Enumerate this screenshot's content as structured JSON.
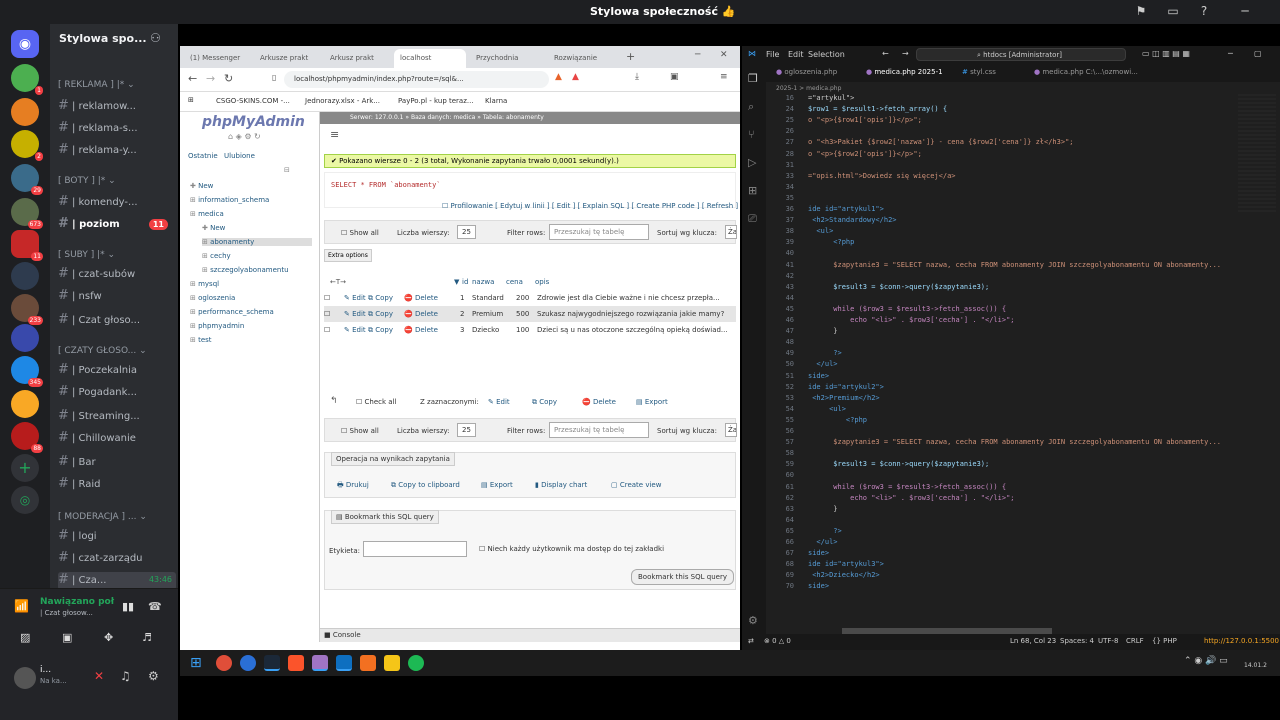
{
  "window": {
    "title": "Stylowa społeczność 👍"
  },
  "discord": {
    "server_name": "Stylowa spo...",
    "server_badges": [
      "1",
      "2",
      "29",
      "673",
      "11",
      "233",
      "345",
      "88"
    ],
    "channels": [
      {
        "type": "cat",
        "label": "[ REKLAMA ] |* ⌄"
      },
      {
        "type": "ch",
        "label": "| reklamow..."
      },
      {
        "type": "ch",
        "label": "| reklama-s..."
      },
      {
        "type": "ch",
        "label": "| reklama-y..."
      },
      {
        "type": "cat",
        "label": "[ BOTY ] |* ⌄"
      },
      {
        "type": "ch",
        "label": "| komendy-..."
      },
      {
        "type": "ch",
        "label": "| poziom",
        "badge": "11"
      },
      {
        "type": "cat",
        "label": "[ SUBY ] |* ⌄"
      },
      {
        "type": "ch",
        "label": "| czat-subów"
      },
      {
        "type": "ch",
        "label": "| nsfw"
      },
      {
        "type": "ch",
        "label": "| Czat głoso..."
      },
      {
        "type": "cat",
        "label": "[ CZATY GŁOSO... ⌄"
      },
      {
        "type": "ch",
        "label": "| Poczekalnia"
      },
      {
        "type": "ch",
        "label": "| Pogadank..."
      },
      {
        "type": "ch",
        "label": "| Streaming..."
      },
      {
        "type": "ch",
        "label": "| Chillowanie"
      },
      {
        "type": "ch",
        "label": "| Bar"
      },
      {
        "type": "ch",
        "label": "| Raid"
      },
      {
        "type": "cat",
        "label": "[ MODERACJA ] ... ⌄"
      },
      {
        "type": "ch",
        "label": "| logi"
      },
      {
        "type": "ch",
        "label": "| czat-zarządu"
      },
      {
        "type": "ch",
        "label": "| Cza...",
        "time": "43:46"
      }
    ],
    "voice": {
      "status": "Nawiązano poł",
      "channel": "| Czat głosow...",
      "user": "i...",
      "user_status": "Na ka..."
    }
  },
  "browser": {
    "tabs": [
      "(1) Messenger",
      "Arkusze prakt",
      "Arkusz prakt",
      "localhost",
      "Przychodnia",
      "Rozwiązanie"
    ],
    "url": "localhost/phpmyadmin/index.php?route=/sql&...",
    "bookmarks": [
      "CSGO-SKINS.COM -...",
      "Jednorazy.xlsx - Ark...",
      "PayPo.pl - kup teraz...",
      "Klarna"
    ]
  },
  "pma": {
    "logo": "phpMyAdmin",
    "tabs": [
      "Ostatnie",
      "Ulubione"
    ],
    "breadcrumb": "Serwer: 127.0.0.1 » Baza danych: medica » Tabela: abonamenty",
    "tree": [
      "New",
      "information_schema",
      "medica",
      "New",
      "abonamenty",
      "cechy",
      "szczegolyabonamentu",
      "mysql",
      "ogloszenia",
      "performance_schema",
      "phpmyadmin",
      "test"
    ],
    "success": "Pokazano wiersze 0 - 2 (3 total, Wykonanie zapytania trwało 0,0001 sekund(y).)",
    "sql": "SELECT * FROM `abonamenty`",
    "profiling": "Profilowanie [ Edytuj w linii ] [ Edit ] [ Explain SQL ] [ Create PHP code ] [ Refresh ]",
    "show_all": "Show all",
    "rows_label": "Liczba wierszy:",
    "rows_value": "25",
    "filter_label": "Filter rows:",
    "filter_ph": "Przeszukaj tę tabelę",
    "sort_label": "Sortuj wg klucza:",
    "sort_value": "Żaden",
    "extra": "Extra options",
    "cols": [
      "id",
      "nazwa",
      "cena",
      "opis"
    ],
    "rows": [
      {
        "id": "1",
        "nazwa": "Standard",
        "cena": "200",
        "opis": "Zdrowie jest dla Ciebie ważne i nie chcesz przepła..."
      },
      {
        "id": "2",
        "nazwa": "Premium",
        "cena": "500",
        "opis": "Szukasz najwygodniejszego rozwiązania jakie mamy?"
      },
      {
        "id": "3",
        "nazwa": "Dziecko",
        "cena": "100",
        "opis": "Dzieci są u nas otoczone szczególną opieką doświad..."
      }
    ],
    "row_actions": [
      "Edit",
      "Copy",
      "Delete"
    ],
    "bulk": [
      "Check all",
      "Z zaznaczonymi:",
      "Edit",
      "Copy",
      "Delete",
      "Export"
    ],
    "ops_title": "Operacja na wynikach zapytania",
    "ops": [
      "Drukuj",
      "Copy to clipboard",
      "Export",
      "Display chart",
      "Create view"
    ],
    "bookmark_title": "Bookmark this SQL query",
    "label_field": "Etykieta:",
    "allow": "Niech każdy użytkownik ma dostęp do tej zakładki",
    "bookmark_btn": "Bookmark this SQL query",
    "console": "Console"
  },
  "vscode": {
    "menu": [
      "File",
      "Edit",
      "Selection"
    ],
    "search": "htdocs [Administrator]",
    "tabs": [
      "ogloszenia.php",
      "medica.php 2025-1",
      "styl.css",
      "medica.php C:\\...\\ozmowi..."
    ],
    "breadcrumb": "2025-1 > medica.php",
    "lines": [
      {
        "n": "16",
        "t": "=\"artykul\">"
      },
      {
        "n": "24",
        "t": "$row1 = $result1->fetch_array() {"
      },
      {
        "n": "25",
        "t": "o \"<p>{$row1['opis']}</p>\";"
      },
      {
        "n": "26",
        "t": ""
      },
      {
        "n": "27",
        "t": "o \"<h3>Pakiet {$row2['nazwa']} - cena {$row2['cena']} zł</h3>\";"
      },
      {
        "n": "28",
        "t": "o \"<p>{$row2['opis']}</p>\";"
      },
      {
        "n": "31",
        "t": ""
      },
      {
        "n": "33",
        "t": "=\"opis.html\">Dowiedz się więcej</a>"
      },
      {
        "n": "34",
        "t": ""
      },
      {
        "n": "35",
        "t": ""
      },
      {
        "n": "36",
        "t": "ide id=\"artykul1\">"
      },
      {
        "n": "37",
        "t": " <h2>Standardowy</h2>"
      },
      {
        "n": "38",
        "t": "  <ul>"
      },
      {
        "n": "39",
        "t": "      <?php"
      },
      {
        "n": "40",
        "t": ""
      },
      {
        "n": "41",
        "t": "      $zapytanie3 = \"SELECT nazwa, cecha FROM abonamenty JOIN szczegolyabonamentu ON abonamenty..."
      },
      {
        "n": "42",
        "t": ""
      },
      {
        "n": "43",
        "t": "      $result3 = $conn->query($zapytanie3);"
      },
      {
        "n": "44",
        "t": ""
      },
      {
        "n": "45",
        "t": "      while ($row3 = $result3->fetch_assoc()) {"
      },
      {
        "n": "46",
        "t": "          echo \"<li>\" . $row3['cecha'] . \"</li>\";"
      },
      {
        "n": "47",
        "t": "      }"
      },
      {
        "n": "48",
        "t": ""
      },
      {
        "n": "49",
        "t": "      ?>"
      },
      {
        "n": "50",
        "t": "  </ul>"
      },
      {
        "n": "51",
        "t": "side>"
      },
      {
        "n": "52",
        "t": "ide id=\"artykul2\">"
      },
      {
        "n": "53",
        "t": " <h2>Premium</h2>"
      },
      {
        "n": "54",
        "t": "     <ul>"
      },
      {
        "n": "55",
        "t": "         <?php"
      },
      {
        "n": "56",
        "t": ""
      },
      {
        "n": "57",
        "t": "      $zapytanie3 = \"SELECT nazwa, cecha FROM abonamenty JOIN szczegolyabonamentu ON abonamenty..."
      },
      {
        "n": "58",
        "t": ""
      },
      {
        "n": "59",
        "t": "      $result3 = $conn->query($zapytanie3);"
      },
      {
        "n": "60",
        "t": ""
      },
      {
        "n": "61",
        "t": "      while ($row3 = $result3->fetch_assoc()) {"
      },
      {
        "n": "62",
        "t": "          echo \"<li>\" . $row3['cecha'] . \"</li>\";"
      },
      {
        "n": "63",
        "t": "      }"
      },
      {
        "n": "64",
        "t": ""
      },
      {
        "n": "65",
        "t": "      ?>"
      },
      {
        "n": "66",
        "t": "  </ul>"
      },
      {
        "n": "67",
        "t": "side>"
      },
      {
        "n": "68",
        "t": "ide id=\"artykul3\">"
      },
      {
        "n": "69",
        "t": " <h2>Dziecko</h2>"
      },
      {
        "n": "70",
        "t": "side>"
      }
    ],
    "status": [
      "⊗ 0 △ 0",
      "Ln 68, Col 23",
      "Spaces: 4",
      "UTF-8",
      "CRLF",
      "{} PHP",
      "http://127.0.0.1:5500"
    ]
  },
  "taskbar": {
    "date": "14.01.2"
  }
}
